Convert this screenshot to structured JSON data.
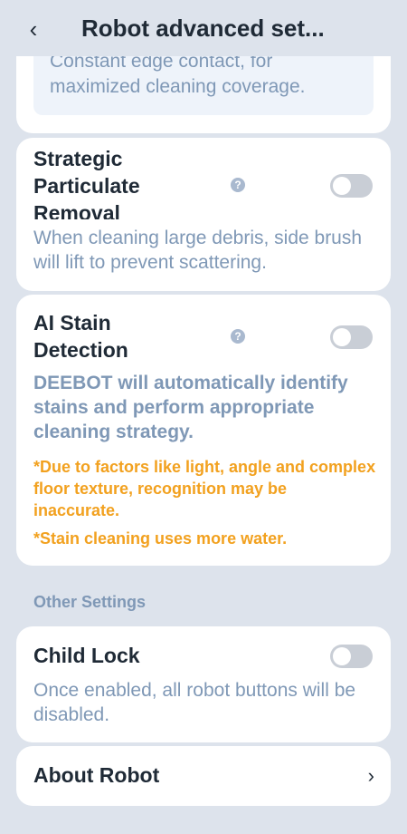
{
  "header": {
    "back_icon": "chevron-left-icon",
    "back_glyph": "‹",
    "title": "Robot advanced set..."
  },
  "edge_card": {
    "description": "Constant edge contact, for maximized cleaning coverage."
  },
  "strategic_card": {
    "title": "Strategic Particulate Removal",
    "help_icon": "question-icon",
    "help_glyph": "?",
    "enabled": false,
    "description": "When cleaning large debris, side brush will lift to prevent scattering."
  },
  "ai_stain_card": {
    "title": "AI Stain Detection",
    "help_icon": "question-icon",
    "help_glyph": "?",
    "enabled": false,
    "description": "DEEBOT will automatically identify stains and perform appropriate cleaning strategy.",
    "warning_1": "*Due to factors like light, angle and complex floor texture, recognition may be inaccurate.",
    "warning_2": "*Stain cleaning uses more water."
  },
  "other_settings": {
    "section_label": "Other Settings"
  },
  "child_lock_card": {
    "title": "Child Lock",
    "enabled": false,
    "description": "Once enabled, all robot buttons will be disabled."
  },
  "about_card": {
    "title": "About Robot",
    "chevron_icon": "chevron-right-icon",
    "chevron_glyph": "›"
  },
  "colors": {
    "background": "#dde3ec",
    "card": "#ffffff",
    "muted_text": "#7f98b6",
    "warning": "#f2a11f",
    "toggle_off": "#c9ced6"
  }
}
